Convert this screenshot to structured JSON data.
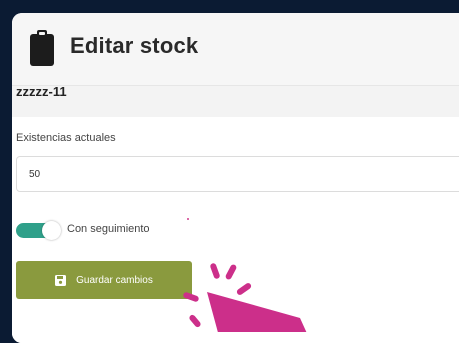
{
  "header": {
    "title": "Editar stock",
    "icon": "clipboard-icon"
  },
  "product": {
    "name": "zzzzz-11"
  },
  "stock_field": {
    "label": "Existencias actuales",
    "value": "50"
  },
  "tracking": {
    "label": "Con seguimiento",
    "enabled": true
  },
  "save_button": {
    "label": "Guardar cambios",
    "icon": "floppy-disk-icon"
  },
  "colors": {
    "accent_button": "#8a9a3e",
    "toggle_on": "#2fa08a",
    "cursor_highlight": "#cc2f8a",
    "page_background": "#0b1b33"
  }
}
